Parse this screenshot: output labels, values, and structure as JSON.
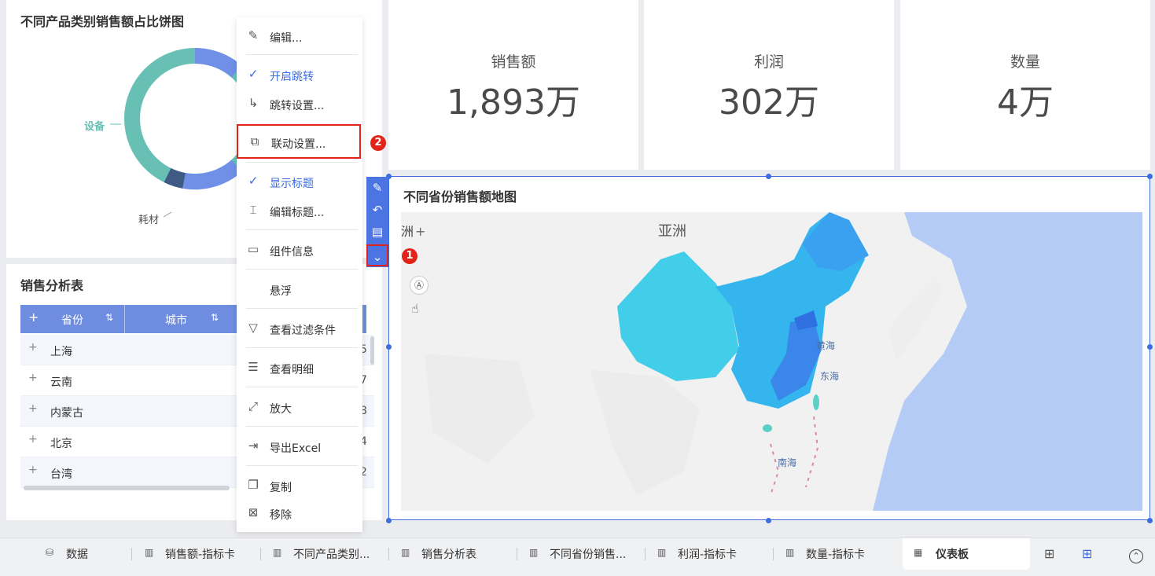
{
  "pie_card": {
    "title": "不同产品类别销售额占比饼图",
    "labels": [
      "设备",
      "耗材"
    ]
  },
  "table_card": {
    "title": "销售分析表",
    "add_icon": "+",
    "columns": [
      "省份",
      "城市"
    ],
    "rows": [
      {
        "name": "上海",
        "val": "5"
      },
      {
        "name": "云南",
        "val": "7"
      },
      {
        "name": "内蒙古",
        "val": "8"
      },
      {
        "name": "北京",
        "val": "4"
      },
      {
        "name": "台湾",
        "val": "2"
      }
    ]
  },
  "kpis": [
    {
      "label": "销售额",
      "value": "1,893万"
    },
    {
      "label": "利润",
      "value": "302万"
    },
    {
      "label": "数量",
      "value": "4万"
    }
  ],
  "map_card": {
    "title": "不同省份销售额地图",
    "zoom_in": "+",
    "continent_label": "亚洲",
    "edge_label": "洲",
    "sea_labels": [
      "黄海",
      "东海",
      "南海"
    ]
  },
  "menu": {
    "items": [
      {
        "label": "编辑...",
        "icon": "pencil-icon"
      },
      {
        "label": "开启跳转",
        "icon": "check-icon",
        "checked": true
      },
      {
        "label": "跳转设置...",
        "icon": "redirect-arrow-icon"
      },
      {
        "label": "联动设置...",
        "icon": "link-settings-icon"
      },
      {
        "label": "显示标题",
        "icon": "check-icon",
        "checked": true
      },
      {
        "label": "编辑标题...",
        "icon": "edit-title-icon"
      },
      {
        "label": "组件信息",
        "icon": "info-icon"
      },
      {
        "label": "悬浮",
        "icon": ""
      },
      {
        "label": "查看过滤条件",
        "icon": "filter-icon"
      },
      {
        "label": "查看明细",
        "icon": "detail-icon"
      },
      {
        "label": "放大",
        "icon": "zoom-icon"
      },
      {
        "label": "导出Excel",
        "icon": "export-icon"
      },
      {
        "label": "复制",
        "icon": "copy-icon"
      },
      {
        "label": "移除",
        "icon": "remove-icon"
      }
    ]
  },
  "badges": [
    "1",
    "2"
  ],
  "tabs": [
    {
      "label": "数据",
      "icon": "database-icon"
    },
    {
      "label": "销售额-指标卡",
      "icon": "chart-icon"
    },
    {
      "label": "不同产品类别...",
      "icon": "chart-icon"
    },
    {
      "label": "销售分析表",
      "icon": "chart-icon"
    },
    {
      "label": "不同省份销售...",
      "icon": "chart-icon"
    },
    {
      "label": "利润-指标卡",
      "icon": "chart-icon"
    },
    {
      "label": "数量-指标卡",
      "icon": "chart-icon"
    },
    {
      "label": "仪表板",
      "icon": "dashboard-icon",
      "active": true
    }
  ],
  "colors": {
    "accent": "#3e6de0",
    "highlight_red": "#e2231a",
    "pie_equipment": "#68c0b5",
    "pie_other": "#7090e8",
    "pie_consumables": "#3f5a85"
  }
}
